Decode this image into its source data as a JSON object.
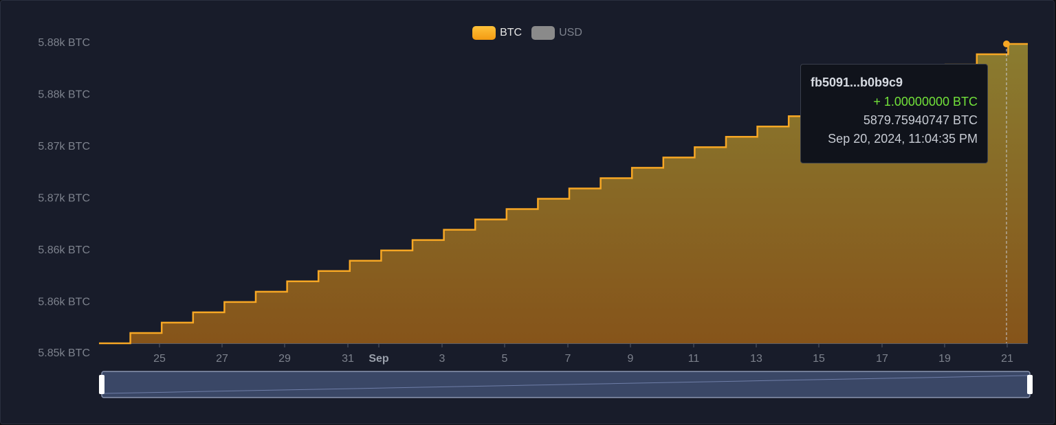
{
  "legend": [
    {
      "label": "BTC",
      "color": "#f7a724",
      "active": true
    },
    {
      "label": "USD",
      "color": "#8a8a8a",
      "active": false
    }
  ],
  "chart_data": {
    "type": "line",
    "title": "",
    "step": true,
    "x_ticks": [
      "25",
      "27",
      "29",
      "31",
      "Sep",
      "3",
      "5",
      "7",
      "9",
      "11",
      "13",
      "15",
      "17",
      "19",
      "21"
    ],
    "y_ticks": [
      "5.88k BTC",
      "5.88k BTC",
      "5.87k BTC",
      "5.87k BTC",
      "5.86k BTC",
      "5.86k BTC",
      "5.85k BTC"
    ],
    "ylim": [
      5850,
      5880
    ],
    "series": [
      {
        "name": "BTC",
        "color": "#f7a724",
        "x": [
          "2024-08-23",
          "2024-08-24",
          "2024-08-25",
          "2024-08-26",
          "2024-08-27",
          "2024-08-28",
          "2024-08-29",
          "2024-08-30",
          "2024-08-31",
          "2024-09-01",
          "2024-09-02",
          "2024-09-03",
          "2024-09-04",
          "2024-09-05",
          "2024-09-06",
          "2024-09-07",
          "2024-09-08",
          "2024-09-09",
          "2024-09-10",
          "2024-09-11",
          "2024-09-12",
          "2024-09-13",
          "2024-09-14",
          "2024-09-15",
          "2024-09-16",
          "2024-09-17",
          "2024-09-18",
          "2024-09-19",
          "2024-09-20",
          "2024-09-21"
        ],
        "values": [
          5850.76,
          5851.76,
          5852.76,
          5853.76,
          5854.76,
          5855.76,
          5856.76,
          5857.76,
          5858.76,
          5859.76,
          5860.76,
          5861.76,
          5862.76,
          5863.76,
          5864.76,
          5865.76,
          5866.76,
          5867.76,
          5868.76,
          5869.76,
          5870.76,
          5871.76,
          5872.76,
          5873.76,
          5874.76,
          5875.76,
          5876.76,
          5877.76,
          5878.76,
          5879.76
        ]
      }
    ],
    "grid": false,
    "legend_position": "top-center"
  },
  "tooltip": {
    "title": "fb5091...b0b9c9",
    "change": "+ 1.00000000 BTC",
    "balance": "5879.75940747 BTC",
    "datetime": "Sep 20, 2024, 11:04:35 PM"
  },
  "colors": {
    "background": "#181c2a",
    "axis_text": "#7d828d",
    "line": "#f7a724",
    "change_positive": "#72e23a"
  }
}
